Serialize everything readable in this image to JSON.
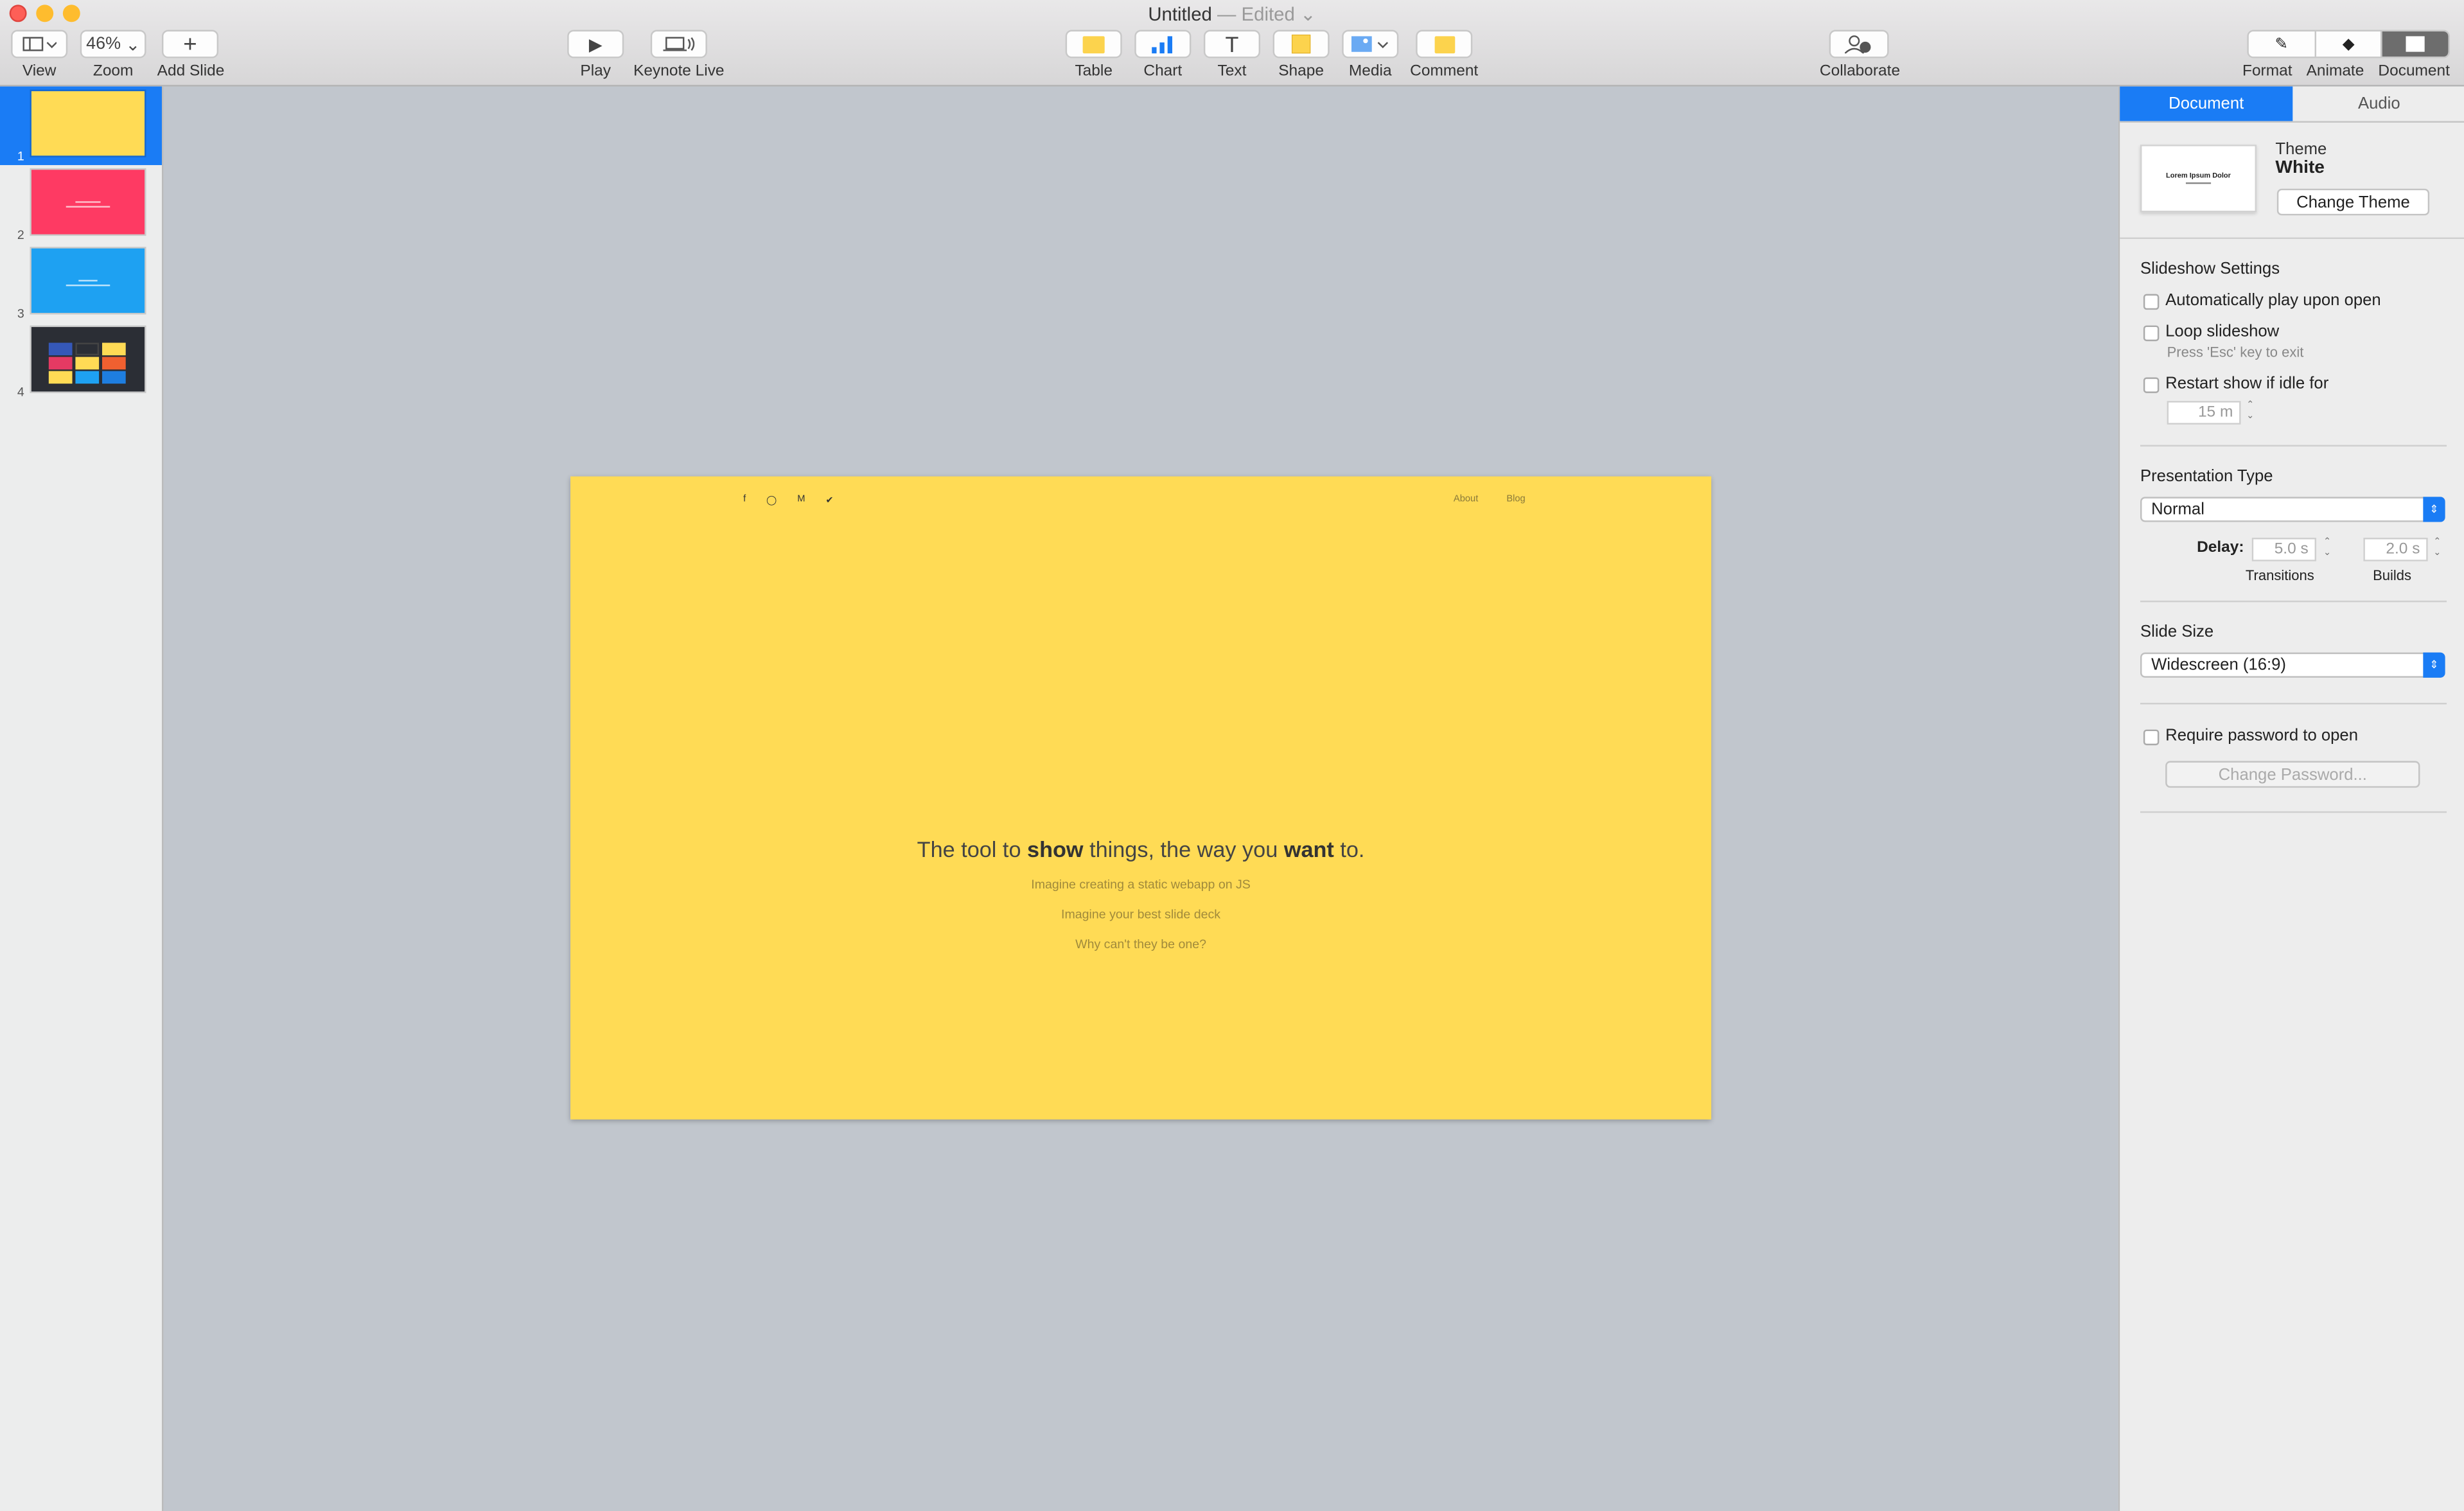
{
  "window": {
    "title": "Untitled",
    "edited": "— Edited"
  },
  "toolbar": {
    "view": "View",
    "zoom_value": "46%",
    "zoom": "Zoom",
    "add_slide": "Add Slide",
    "play": "Play",
    "keynote_live": "Keynote Live",
    "table": "Table",
    "chart": "Chart",
    "text": "Text",
    "shape": "Shape",
    "media": "Media",
    "comment": "Comment",
    "collaborate": "Collaborate",
    "format": "Format",
    "animate": "Animate",
    "document": "Document"
  },
  "navigator": {
    "slides": [
      "1",
      "2",
      "3",
      "4"
    ],
    "selected": "1"
  },
  "slide": {
    "social": [
      "f",
      "◯",
      "M",
      "✔"
    ],
    "nav": [
      "About",
      "Blog"
    ],
    "headline_pre": "The tool to ",
    "headline_b1": "show",
    "headline_mid": " things, the way you ",
    "headline_b2": "want",
    "headline_post": " to.",
    "lines": [
      "Imagine creating a static webapp on JS",
      "Imagine your best slide deck",
      "Why can't they be one?"
    ]
  },
  "inspector": {
    "tabs": [
      "Document",
      "Audio"
    ],
    "theme_label": "Theme",
    "theme_name": "White",
    "theme_thumb_title": "Lorem Ipsum Dolor",
    "change_theme": "Change Theme",
    "slideshow_settings": "Slideshow Settings",
    "auto_play": "Automatically play upon open",
    "loop": "Loop slideshow",
    "loop_hint": "Press 'Esc' key to exit",
    "restart": "Restart show if idle for",
    "idle_value": "15 m",
    "presentation_type": "Presentation Type",
    "presentation_value": "Normal",
    "delay": "Delay:",
    "transitions_value": "5.0 s",
    "builds_value": "2.0 s",
    "transitions": "Transitions",
    "builds": "Builds",
    "slide_size": "Slide Size",
    "slide_size_value": "Widescreen (16:9)",
    "require_password": "Require password to open",
    "change_password": "Change Password..."
  },
  "colors": {
    "accent": "#1a7cf5",
    "slide1": "#ffdb55",
    "slide2": "#fe3a63",
    "slide3": "#1ea1f2",
    "slide4": "#2b2e35"
  }
}
